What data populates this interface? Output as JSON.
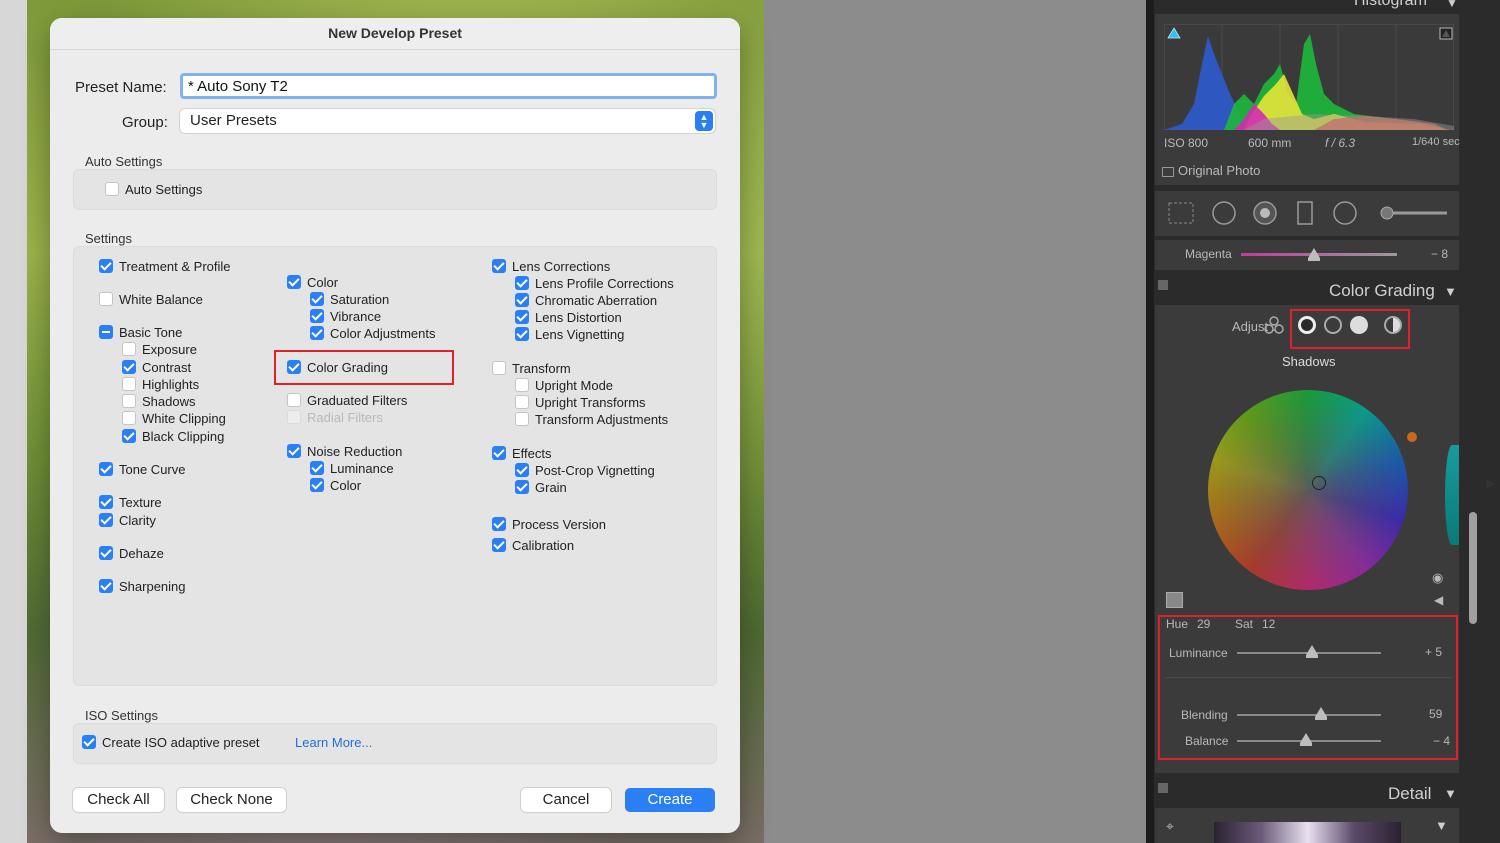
{
  "dialog": {
    "title": "New Develop Preset",
    "preset_name_label": "Preset Name:",
    "preset_name_value": "* Auto Sony T2",
    "group_label": "Group:",
    "group_value": "User Presets",
    "auto_settings_section": "Auto Settings",
    "auto_settings_checkbox": "Auto Settings",
    "settings_section": "Settings",
    "iso_section": "ISO Settings",
    "iso_checkbox": "Create ISO adaptive preset",
    "learn_more": "Learn More...",
    "buttons": {
      "check_all": "Check All",
      "check_none": "Check None",
      "cancel": "Cancel",
      "create": "Create"
    },
    "settings": {
      "treatment_profile": "Treatment & Profile",
      "white_balance": "White Balance",
      "basic_tone": "Basic Tone",
      "exposure": "Exposure",
      "contrast": "Contrast",
      "highlights": "Highlights",
      "shadows": "Shadows",
      "white_clipping": "White Clipping",
      "black_clipping": "Black Clipping",
      "tone_curve": "Tone Curve",
      "texture": "Texture",
      "clarity": "Clarity",
      "dehaze": "Dehaze",
      "sharpening": "Sharpening",
      "color": "Color",
      "saturation": "Saturation",
      "vibrance": "Vibrance",
      "color_adjustments": "Color Adjustments",
      "color_grading": "Color Grading",
      "graduated_filters": "Graduated Filters",
      "radial_filters": "Radial Filters",
      "noise_reduction": "Noise Reduction",
      "luminance": "Luminance",
      "nr_color": "Color",
      "lens_corrections": "Lens Corrections",
      "lens_profile_corrections": "Lens Profile Corrections",
      "chromatic_aberration": "Chromatic Aberration",
      "lens_distortion": "Lens Distortion",
      "lens_vignetting": "Lens Vignetting",
      "transform": "Transform",
      "upright_mode": "Upright Mode",
      "upright_transforms": "Upright Transforms",
      "transform_adjustments": "Transform Adjustments",
      "effects": "Effects",
      "post_crop_vignetting": "Post-Crop Vignetting",
      "grain": "Grain",
      "process_version": "Process Version",
      "calibration": "Calibration"
    }
  },
  "lightroom": {
    "histogram_title": "Histogram",
    "iso": "ISO 800",
    "focal": "600 mm",
    "aperture": "f / 6.3",
    "shutter": "1/640 sec",
    "original_photo": "Original Photo",
    "magenta_label": "Magenta",
    "magenta_value": "− 8",
    "color_grading_title": "Color Grading",
    "adjust_label": "Adjust :",
    "shadows_label": "Shadows",
    "hue_label": "Hue",
    "hue_value": "29",
    "sat_label": "Sat",
    "sat_value": "12",
    "luminance_label": "Luminance",
    "luminance_value": "+ 5",
    "blending_label": "Blending",
    "blending_value": "59",
    "balance_label": "Balance",
    "balance_value": "− 4",
    "detail_title": "Detail",
    "colors": {
      "accent_red": "#e0202a",
      "checkbox_blue": "#2a7ff5"
    }
  }
}
